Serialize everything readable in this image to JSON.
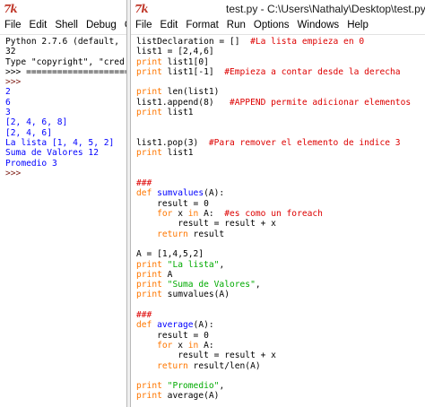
{
  "shell": {
    "menu": [
      "File",
      "Edit",
      "Shell",
      "Debug",
      "Optio"
    ],
    "lines": [
      {
        "t": "Python 2.7.6 (default,",
        "c": ""
      },
      {
        "t": "32",
        "c": ""
      },
      {
        "t": "Type \"copyright\", \"cred",
        "c": ""
      },
      {
        "t": ">>> ==========================",
        "c": ""
      },
      {
        "t": ">>>",
        "c": "prompt"
      },
      {
        "t": "2",
        "c": "out"
      },
      {
        "t": "6",
        "c": "out"
      },
      {
        "t": "3",
        "c": "out"
      },
      {
        "t": "[2, 4, 6, 8]",
        "c": "out"
      },
      {
        "t": "[2, 4, 6]",
        "c": "out"
      },
      {
        "t": "La lista [1, 4, 5, 2]",
        "c": "out"
      },
      {
        "t": "Suma de Valores 12",
        "c": "out"
      },
      {
        "t": "Promedio 3",
        "c": "out"
      },
      {
        "t": ">>>",
        "c": "prompt"
      }
    ]
  },
  "editor": {
    "title": "test.py - C:\\Users\\Nathaly\\Desktop\\test.py",
    "menu": [
      "File",
      "Edit",
      "Format",
      "Run",
      "Options",
      "Windows",
      "Help"
    ],
    "lines": [
      [
        [
          "listDeclaration = []  ",
          ""
        ],
        [
          "#La lista empieza en 0",
          "cm"
        ]
      ],
      [
        [
          "list1 = [2,4,6]",
          ""
        ]
      ],
      [
        [
          "print",
          "kw"
        ],
        [
          " list1[0]",
          ""
        ]
      ],
      [
        [
          "print",
          "kw"
        ],
        [
          " list1[-1]  ",
          ""
        ],
        [
          "#Empieza a contar desde la derecha",
          "cm"
        ]
      ],
      [
        [
          "",
          ""
        ]
      ],
      [
        [
          "print",
          "kw"
        ],
        [
          " len(list1)",
          ""
        ]
      ],
      [
        [
          "list1.append(8)   ",
          ""
        ],
        [
          "#APPEND permite adicionar elementos",
          "cm"
        ]
      ],
      [
        [
          "print",
          "kw"
        ],
        [
          " list1",
          ""
        ]
      ],
      [
        [
          "",
          ""
        ]
      ],
      [
        [
          "",
          ""
        ]
      ],
      [
        [
          "list1.pop(3)  ",
          ""
        ],
        [
          "#Para remover el elemento de indice 3",
          "cm"
        ]
      ],
      [
        [
          "print",
          "kw"
        ],
        [
          " list1",
          ""
        ]
      ],
      [
        [
          "",
          ""
        ]
      ],
      [
        [
          "",
          ""
        ]
      ],
      [
        [
          "###",
          "cm"
        ]
      ],
      [
        [
          "def",
          "kw"
        ],
        [
          " ",
          ""
        ],
        [
          "sumvalues",
          "df"
        ],
        [
          "(A):",
          ""
        ]
      ],
      [
        [
          "    result = 0",
          ""
        ]
      ],
      [
        [
          "    ",
          ""
        ],
        [
          "for",
          "kw"
        ],
        [
          " x ",
          ""
        ],
        [
          "in",
          "kw"
        ],
        [
          " A:  ",
          ""
        ],
        [
          "#es como un foreach",
          "cm"
        ]
      ],
      [
        [
          "        result = result + x",
          ""
        ]
      ],
      [
        [
          "    ",
          ""
        ],
        [
          "return",
          "kw"
        ],
        [
          " result",
          ""
        ]
      ],
      [
        [
          "",
          ""
        ]
      ],
      [
        [
          "A = [1,4,5,2]",
          ""
        ]
      ],
      [
        [
          "print",
          "kw"
        ],
        [
          " ",
          ""
        ],
        [
          "\"La lista\"",
          "st"
        ],
        [
          ",",
          ""
        ]
      ],
      [
        [
          "print",
          "kw"
        ],
        [
          " A",
          ""
        ]
      ],
      [
        [
          "print",
          "kw"
        ],
        [
          " ",
          ""
        ],
        [
          "\"Suma de Valores\"",
          "st"
        ],
        [
          ",",
          ""
        ]
      ],
      [
        [
          "print",
          "kw"
        ],
        [
          " sumvalues(A)",
          ""
        ]
      ],
      [
        [
          "",
          ""
        ]
      ],
      [
        [
          "###",
          "cm"
        ]
      ],
      [
        [
          "def",
          "kw"
        ],
        [
          " ",
          ""
        ],
        [
          "average",
          "df"
        ],
        [
          "(A):",
          ""
        ]
      ],
      [
        [
          "    result = 0",
          ""
        ]
      ],
      [
        [
          "    ",
          ""
        ],
        [
          "for",
          "kw"
        ],
        [
          " x ",
          ""
        ],
        [
          "in",
          "kw"
        ],
        [
          " A:",
          ""
        ]
      ],
      [
        [
          "        result = result + x",
          ""
        ]
      ],
      [
        [
          "    ",
          ""
        ],
        [
          "return",
          "kw"
        ],
        [
          " result/len(A)",
          ""
        ]
      ],
      [
        [
          "",
          ""
        ]
      ],
      [
        [
          "print",
          "kw"
        ],
        [
          " ",
          ""
        ],
        [
          "\"Promedio\"",
          "st"
        ],
        [
          ",",
          ""
        ]
      ],
      [
        [
          "print",
          "kw"
        ],
        [
          " average(A)",
          ""
        ]
      ]
    ]
  }
}
